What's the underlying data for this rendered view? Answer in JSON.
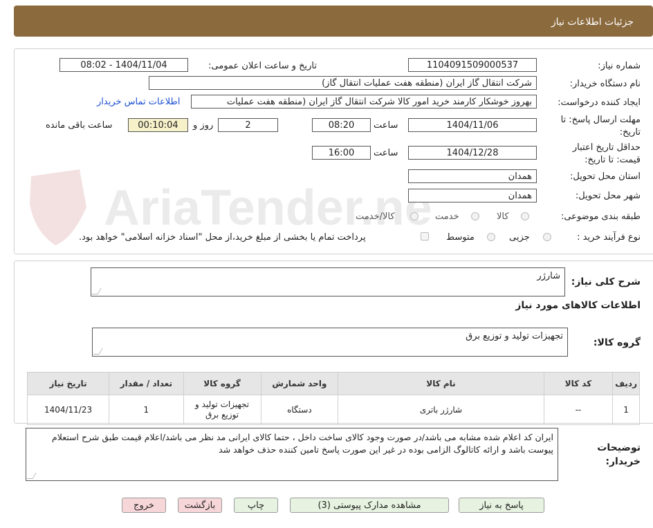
{
  "header": {
    "title": "جزئیات اطلاعات نیاز"
  },
  "form": {
    "need_number_label": "شماره نیاز:",
    "need_number": "1104091509000537",
    "announce_label": "تاریخ و ساعت اعلان عمومی:",
    "announce_value": "1404/11/04 - 08:02",
    "buyer_org_label": "نام دستگاه خریدار:",
    "buyer_org": "شرکت انتقال گاز ایران (منطقه هفت عملیات انتقال گاز)",
    "creator_label": "ایجاد کننده درخواست:",
    "creator": "بهروز خوشکار کارمند خرید امور کالا شرکت انتقال گاز ایران (منطقه هفت عملیات",
    "contact_link": "اطلاعات تماس خریدار",
    "deadline_label_1": "مهلت ارسال پاسخ: تا",
    "deadline_label_2": "تاریخ:",
    "deadline_date": "1404/11/06",
    "time_label": "ساعت",
    "deadline_time": "08:20",
    "days_value": "2",
    "days_label": "روز و",
    "remaining_time": "00:10:04",
    "remaining_label": "ساعت باقی مانده",
    "validity_label_1": "حداقل تاریخ اعتبار",
    "validity_label_2": "قیمت: تا تاریخ:",
    "validity_date": "1404/12/28",
    "validity_time": "16:00",
    "province_label": "استان محل تحویل:",
    "province": "همدان",
    "city_label": "شهر محل تحویل:",
    "city": "همدان",
    "category_label": "طبقه بندی موضوعی:",
    "category_options": [
      "کالا",
      "خدمت",
      "کالا/خدمت"
    ],
    "process_label": "نوع فرآیند خرید :",
    "process_options": [
      "جزیی",
      "متوسط"
    ],
    "treasury_note": "پرداخت تمام یا بخشی از مبلغ خرید،از محل \"اسناد خزانه اسلامی\" خواهد بود."
  },
  "need": {
    "summary_label": "شرح کلی نیاز:",
    "summary": "شارژر",
    "goods_info_title": "اطلاعات کالاهای مورد نیاز",
    "goods_group_label": "گروه کالا:",
    "goods_group": "تجهیزات تولید و توزیع برق"
  },
  "table": {
    "headers": [
      "ردیف",
      "کد کالا",
      "نام کالا",
      "واحد شمارش",
      "گروه کالا",
      "تعداد / مقدار",
      "تاریخ نیاز"
    ],
    "rows": [
      [
        "1",
        "--",
        "شارژر باتری",
        "دستگاه",
        "تجهیزات تولید و توزیع برق",
        "1",
        "1404/11/23"
      ]
    ]
  },
  "buyer_notes": {
    "label_1": "توضیحات",
    "label_2": "خریدار:",
    "text": "ایران کد اعلام شده مشابه می باشد/در صورت وجود کالای ساخت داخل ، حتما کالای ایرانی مد نظر می باشد/اعلام قیمت طبق شرح استعلام پیوست باشد و ارائه کاتالوگ الزامی بوده در غیر این صورت پاسخ تامین کننده حذف خواهد شد"
  },
  "buttons": {
    "reply": "پاسخ به نیاز",
    "attachments": "مشاهده مدارک پیوستی (3)",
    "print": "چاپ",
    "back": "بازگشت",
    "exit": "خروج"
  },
  "watermark": {
    "text": "AriaTender.neT"
  },
  "colors": {
    "header": "#8b6a3e",
    "link": "#1b4fd1",
    "reply_button": "#e7f3e0",
    "exit_button": "#f7d6d9"
  }
}
